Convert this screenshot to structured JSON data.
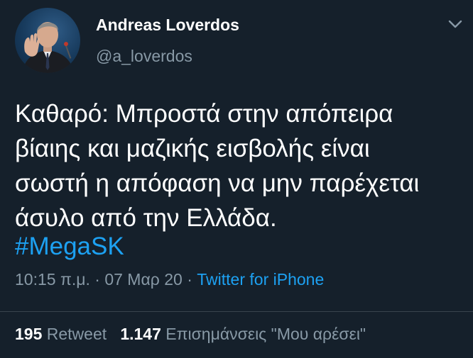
{
  "author": {
    "name": "Andreas Loverdos",
    "handle": "@a_loverdos"
  },
  "tweet": {
    "lines": [
      "Καθαρό: Μπροστά στην απόπειρα",
      "βίαιης και μαζικής εισβολής είναι",
      "σωστή η απόφαση να μην παρέχεται",
      "άσυλο από την Ελλάδα."
    ],
    "hashtag": "#MegaSK"
  },
  "meta": {
    "time": "10:15 π.μ.",
    "date": "07 Μαρ 20",
    "separator": "·",
    "source": "Twitter for iPhone"
  },
  "stats": {
    "retweets_count": "195",
    "retweets_label": "Retweet",
    "likes_count": "1.147",
    "likes_label": "Επισημάνσεις \"Μου αρέσει\""
  },
  "colors": {
    "background": "#15202b",
    "link": "#1da1f2",
    "secondary_text": "#8899a6"
  },
  "icons": {
    "caret": "chevron-down-icon"
  }
}
